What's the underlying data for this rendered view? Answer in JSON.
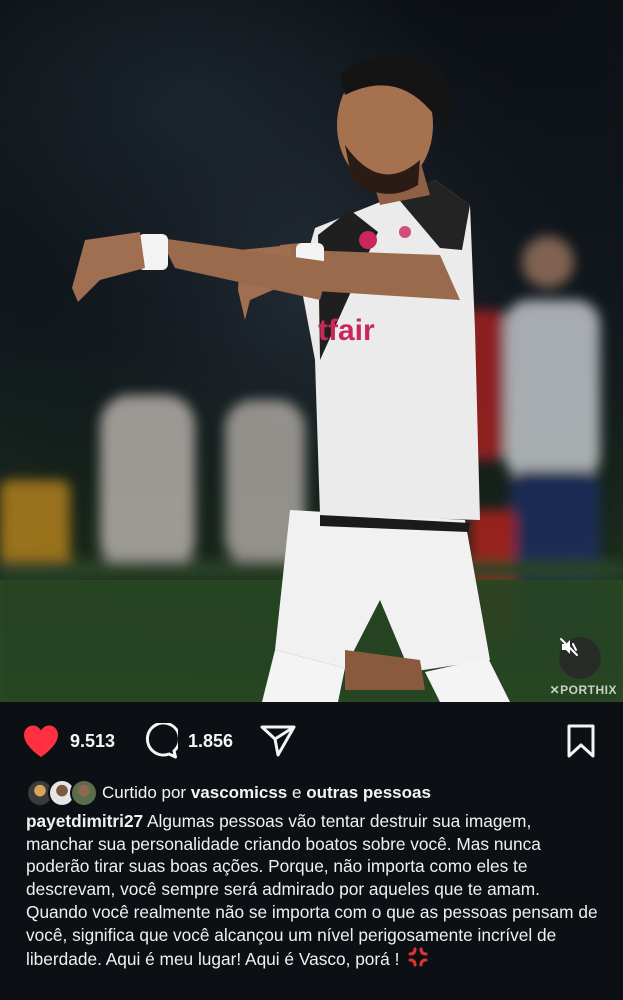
{
  "post": {
    "watermark": "✕PORTHIX",
    "jersey_text": "tfair",
    "likes": "9.513",
    "comments": "1.856",
    "liked_by": {
      "prefix": "Curtido por",
      "user": "vascomicss",
      "connector": "e",
      "others": "outras pessoas"
    },
    "caption": {
      "username": "payetdimitri27",
      "text": "Algumas pessoas vão tentar destruir sua imagem, manchar sua personalidade criando boatos sobre você. Mas nunca poderão tirar suas boas ações. Porque, não importa como eles te descrevam, você sempre será admirado por aqueles que te amam. Quando você realmente não se importa com o que as pessoas pensam de você, significa que você alcançou um nível perigosamente incrível de liberdade. Aqui é meu lugar! Aqui é Vasco, porá !",
      "emoji": "anger-symbol-icon"
    }
  },
  "colors": {
    "like": "#ff3040",
    "background": "#0c1014",
    "text": "#f5f5f5",
    "jersey_accent": "#c8285a"
  }
}
